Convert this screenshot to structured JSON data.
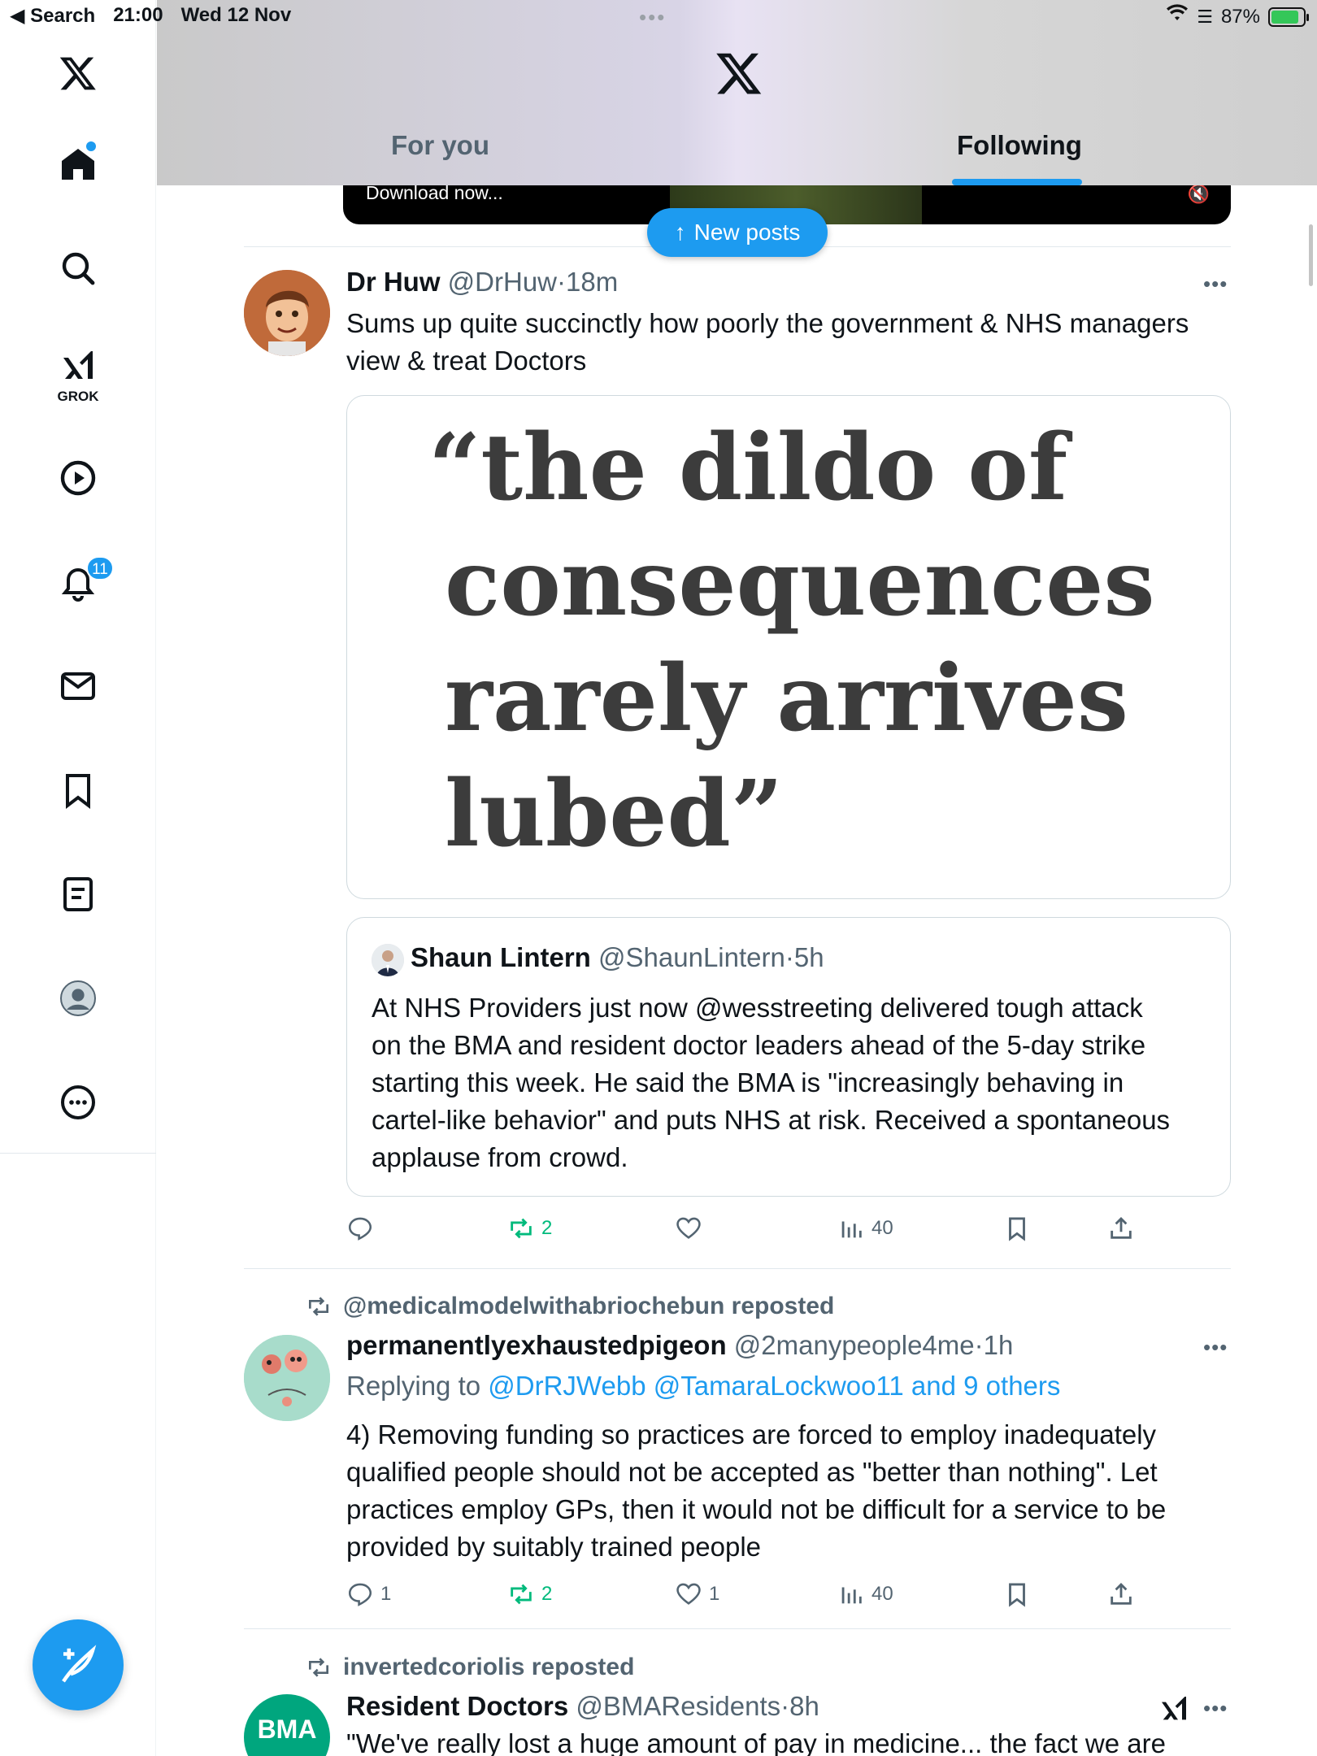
{
  "status_bar": {
    "back_label": "◀ Search",
    "time": "21:00",
    "date": "Wed 12 Nov",
    "battery": "87%"
  },
  "sidebar": {
    "grok_label": "GROK",
    "notifications_badge": "11"
  },
  "header": {
    "tabs": [
      {
        "label": "For you"
      },
      {
        "label": "Following"
      }
    ]
  },
  "promo": {
    "text": "Download now..."
  },
  "new_posts_label": "New posts",
  "posts": [
    {
      "name": "Dr Huw",
      "handle": "@DrHuw",
      "time": "18m",
      "text_line1": "Sums up quite succinctly how poorly the government & NHS managers",
      "text_line2": "view & treat Doctors",
      "image_quote": [
        "“the dildo of",
        "consequences",
        "rarely arrives",
        "lubed”"
      ],
      "quoted": {
        "name": "Shaun Lintern",
        "handle": "@ShaunLintern",
        "time": "5h",
        "lines": [
          "At NHS Providers just now @wesstreeting delivered tough attack",
          "on the BMA and resident doctor leaders ahead of the 5-day strike",
          "starting this week. He said the BMA is \"increasingly behaving in",
          "cartel-like behavior\" and puts NHS at risk. Received a spontaneous",
          "applause from crowd."
        ]
      },
      "stats": {
        "replies": "",
        "reposts": "2",
        "likes": "",
        "views": "40"
      }
    },
    {
      "reposted_by": "@medicalmodelwithabriochebun reposted",
      "name": "permanentlyexhaustedpigeon",
      "handle": "@2manypeople4me",
      "time": "1h",
      "replying_prefix": "Replying to",
      "replying_to": "@DrRJWebb @TamaraLockwoo11 and 9 others",
      "lines": [
        "4) Removing funding so practices are forced to employ inadequately",
        "qualified people should not be accepted as \"better than nothing\". Let",
        "practices employ GPs, then it would not be difficult for a service to be",
        "provided by suitably trained people"
      ],
      "stats": {
        "replies": "1",
        "reposts": "2",
        "likes": "1",
        "views": "40"
      }
    },
    {
      "reposted_by": "invertedcoriolis reposted",
      "name": "Resident Doctors",
      "handle": "@BMAResidents",
      "time": "8h",
      "avatar_text": "BMA",
      "text_line1": "\"We've really lost a huge amount of pay in medicine... the fact we are"
    }
  ],
  "colors": {
    "accent": "#1d9bf0",
    "repost_green": "#00ba7c",
    "muted_text": "#536471"
  }
}
